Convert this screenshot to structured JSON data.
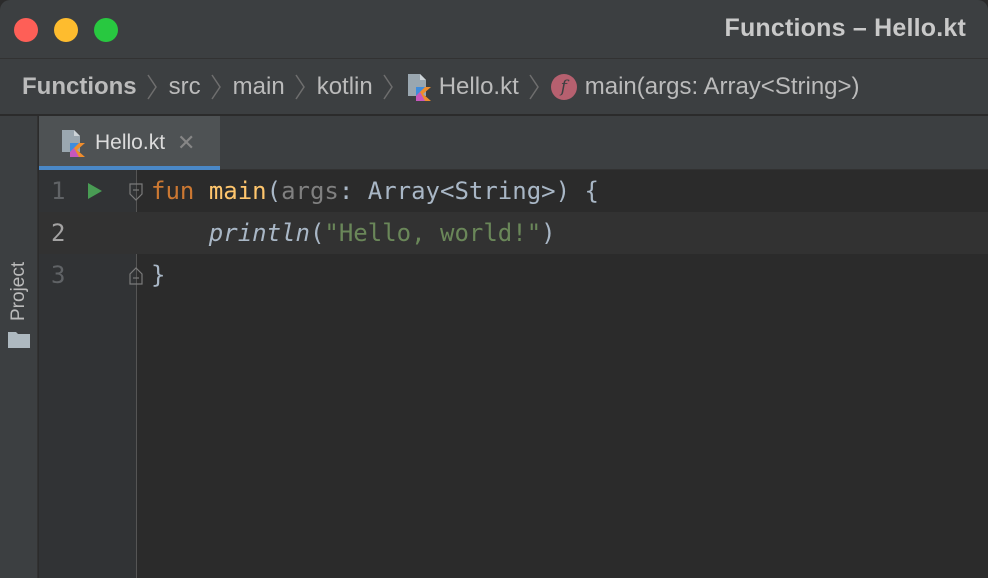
{
  "window": {
    "title": "Functions – Hello.kt",
    "controls": {
      "close_color": "#fe5f57",
      "minimize_color": "#febc2e",
      "maximize_color": "#28c840"
    }
  },
  "breadcrumbs": [
    {
      "label": "Functions"
    },
    {
      "label": "src"
    },
    {
      "label": "main"
    },
    {
      "label": "kotlin"
    },
    {
      "label": "Hello.kt",
      "icon": "kotlin-file-icon"
    },
    {
      "label": "main(args: Array<String>)",
      "icon": "function-icon",
      "badge": "f"
    }
  ],
  "sidebar": {
    "project_label": "Project",
    "icon": "folder-icon"
  },
  "tabs": [
    {
      "label": "Hello.kt",
      "icon": "kotlin-file-icon",
      "active": true,
      "close_glyph": "✕"
    }
  ],
  "editor": {
    "current_line": 2,
    "lines": [
      {
        "number": "1",
        "tokens": [
          {
            "text": "fun",
            "type": "kw"
          },
          {
            "text": " ",
            "type": "plain"
          },
          {
            "text": "main",
            "type": "fn"
          },
          {
            "text": "(",
            "type": "plain"
          },
          {
            "text": "args",
            "type": "param"
          },
          {
            "text": ": Array<String>) {",
            "type": "plain"
          }
        ]
      },
      {
        "number": "2",
        "tokens": [
          {
            "text": "    ",
            "type": "plain"
          },
          {
            "text": "println",
            "type": "call"
          },
          {
            "text": "(",
            "type": "plain"
          },
          {
            "text": "\"Hello, world!\"",
            "type": "str"
          },
          {
            "text": ")",
            "type": "plain"
          }
        ]
      },
      {
        "number": "3",
        "tokens": [
          {
            "text": "}",
            "type": "plain"
          }
        ]
      }
    ]
  },
  "colors": {
    "keyword": "#cc7832",
    "function": "#ffc66d",
    "string": "#6a8759",
    "text": "#a9b7c6",
    "run": "#499c54",
    "tab_underline": "#4a88c7"
  }
}
